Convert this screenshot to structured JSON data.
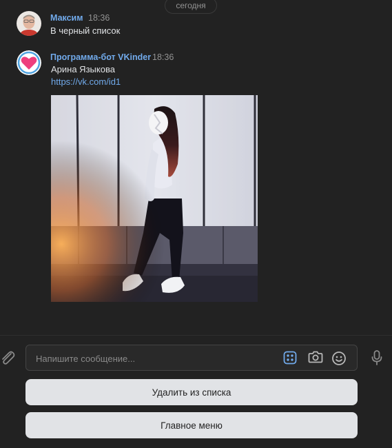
{
  "date_divider": "сегодня",
  "messages": [
    {
      "author": "Максим",
      "time": "18:36",
      "text": "В черный список"
    },
    {
      "author": "Программа-бот VKinder",
      "time": "18:36",
      "text": "Арина Языкова",
      "link": "https://vk.com/id1"
    }
  ],
  "composer": {
    "placeholder": "Напишите сообщение..."
  },
  "keyboard": {
    "buttons": [
      "Удалить из списка",
      "Главное меню"
    ]
  },
  "icons": {
    "attach": "paperclip-icon",
    "keyboard": "bot-keyboard-icon",
    "camera": "camera-icon",
    "emoji": "smile-icon",
    "voice": "microphone-icon"
  },
  "colors": {
    "background": "#222222",
    "accent_link": "#71aaeb",
    "keyboard_button": "#e1e3e6"
  }
}
